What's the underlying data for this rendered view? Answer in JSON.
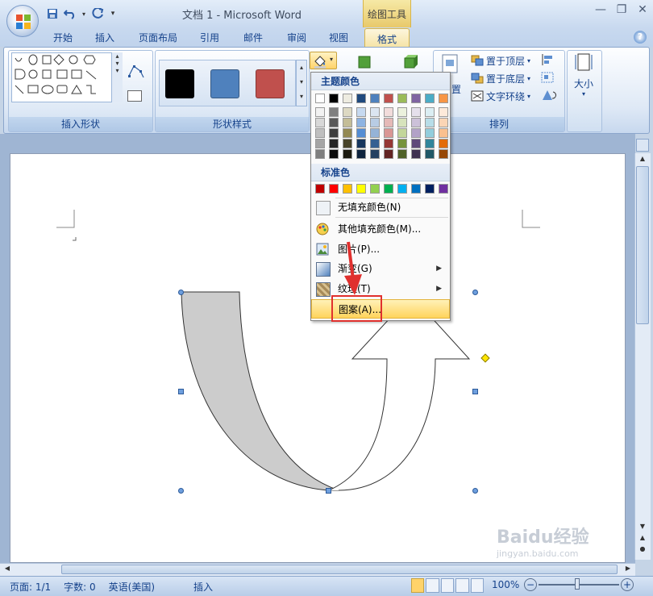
{
  "window": {
    "title": "文档 1 - Microsoft Word",
    "context_tab_group": "绘图工具"
  },
  "ribbon_tabs": [
    "开始",
    "插入",
    "页面布局",
    "引用",
    "邮件",
    "审阅",
    "视图"
  ],
  "active_tab": "格式",
  "ribbon": {
    "groups": {
      "insert_shapes": "插入形状",
      "shape_styles": "形状样式",
      "arrange": "排列"
    },
    "arrange_buttons": {
      "bring_front": "置于顶层",
      "send_back": "置于底层",
      "text_wrap": "文字环绕",
      "position_partial": "置"
    },
    "size_button": "大小",
    "style_colors": [
      "#000000",
      "#4f81bd",
      "#c0504d"
    ]
  },
  "fill_menu": {
    "theme_colors_header": "主题颜色",
    "standard_colors_header": "标准色",
    "theme_top_row": [
      "#ffffff",
      "#000000",
      "#eeece1",
      "#1f497d",
      "#4f81bd",
      "#c0504d",
      "#9bbb59",
      "#8064a2",
      "#4bacc6",
      "#f79646"
    ],
    "theme_shades": [
      [
        "#f2f2f2",
        "#7f7f7f",
        "#ddd9c3",
        "#c6d9f0",
        "#dbe5f1",
        "#f2dcdb",
        "#ebf1dd",
        "#e5e0ec",
        "#dbeef3",
        "#fdeada"
      ],
      [
        "#d8d8d8",
        "#595959",
        "#c4bd97",
        "#8db3e2",
        "#b8cce4",
        "#e5b9b7",
        "#d7e3bc",
        "#ccc1d9",
        "#b7dde8",
        "#fbd5b5"
      ],
      [
        "#bfbfbf",
        "#3f3f3f",
        "#938953",
        "#548dd4",
        "#95b3d7",
        "#d99694",
        "#c3d69b",
        "#b2a2c7",
        "#92cddc",
        "#fac08f"
      ],
      [
        "#a5a5a5",
        "#262626",
        "#494429",
        "#17365d",
        "#366092",
        "#953734",
        "#76923c",
        "#5f497a",
        "#31859b",
        "#e36c09"
      ],
      [
        "#7f7f7f",
        "#0c0c0c",
        "#1d1b10",
        "#0f243e",
        "#244061",
        "#632423",
        "#4f6128",
        "#3f3151",
        "#205867",
        "#974806"
      ]
    ],
    "standard_colors": [
      "#c00000",
      "#ff0000",
      "#ffc000",
      "#ffff00",
      "#92d050",
      "#00b050",
      "#00b0f0",
      "#0070c0",
      "#002060",
      "#7030a0"
    ],
    "items": {
      "no_fill": "无填充颜色(N)",
      "more_fill": "其他填充颜色(M)...",
      "picture": "图片(P)...",
      "gradient": "渐变(G)",
      "texture": "纹理(T)",
      "pattern": "图案(A)..."
    }
  },
  "status_bar": {
    "page": "页面: 1/1",
    "words": "字数: 0",
    "language": "英语(美国)",
    "mode": "插入",
    "zoom": "100%"
  },
  "watermark": {
    "site": "jingyan.baidu.com",
    "brand": "Baidu经验"
  },
  "colors": {
    "accent": "#15428b",
    "highlight_box": "#e0302e",
    "shape_fill": "#cccccc"
  }
}
